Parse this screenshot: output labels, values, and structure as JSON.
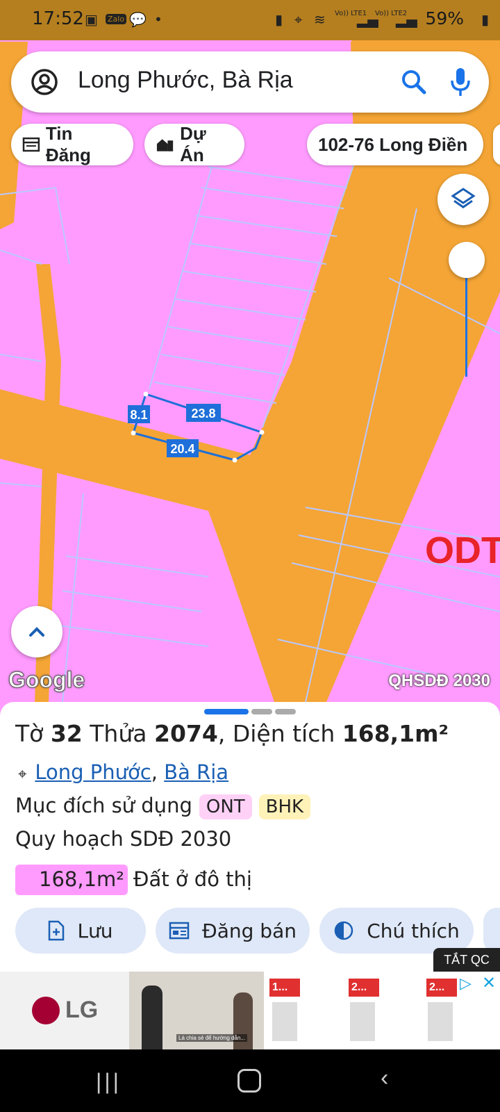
{
  "status_bar": {
    "time": "17:52",
    "network_labels": [
      "Vo)) LTE1",
      "Vo)) LTE2"
    ],
    "battery": "59%"
  },
  "search": {
    "query": "Long Phước, Bà Rịa"
  },
  "chips": {
    "tin_dang": "Tin Đăng",
    "du_an": "Dự Án",
    "address": "102-76 Long Điền"
  },
  "map": {
    "zone_label": "ODT",
    "edge_labels": [
      "8.1",
      "23.8",
      "20.4"
    ],
    "watermark": "Google",
    "layer_name": "QHSDĐ 2030",
    "colors": {
      "residential": "#ff9bff",
      "road": "#f4a535",
      "parcel_line": "#b9c8ff",
      "selection": "#1e6fd9"
    }
  },
  "sheet": {
    "title": {
      "p1": "Tờ ",
      "to": "32",
      "p2": " Thửa ",
      "thua": "2074",
      "p3": ", Diện tích ",
      "area": "168,1m²"
    },
    "location": {
      "ward": "Long Phước",
      "sep": ", ",
      "city": "Bà Rịa"
    },
    "purpose_label": "Mục đích sử dụng",
    "purpose_tags": [
      "ONT",
      "BHK"
    ],
    "plan_label": "Quy hoạch SDĐ 2030",
    "plan_area": "168,1m²",
    "plan_desc": "Đất ở đô thị",
    "actions": {
      "save": "Lưu",
      "post": "Đăng bán",
      "legend": "Chú thích"
    }
  },
  "ad": {
    "close_all": "TẮT QC",
    "brand": "LG",
    "video_caption": "Là chia sẻ để hướng dẫn...",
    "product_labels": [
      "1...",
      "2...",
      "2..."
    ]
  }
}
